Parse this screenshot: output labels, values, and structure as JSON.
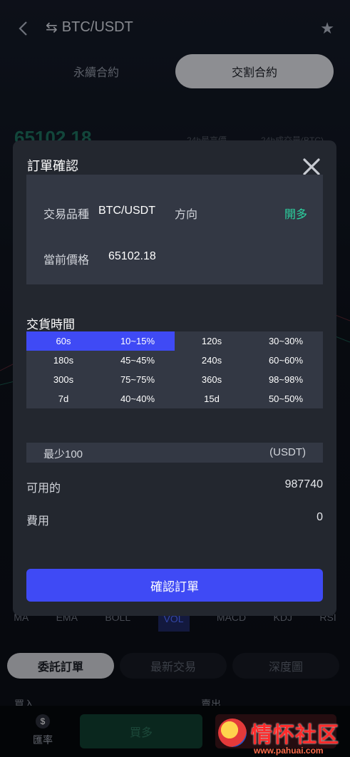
{
  "header": {
    "pair": "BTC/USDT"
  },
  "segments": [
    {
      "label": "永續合約"
    },
    {
      "label": "交割合約"
    }
  ],
  "bg_price": "65102.18",
  "bg_stats": [
    "24h最高價",
    "24h成交量(BTC)"
  ],
  "indicators": [
    "MA",
    "EMA",
    "BOLL",
    "VOL",
    "MACD",
    "KDJ",
    "RSI"
  ],
  "subtabs": [
    {
      "label": "委託訂單"
    },
    {
      "label": "最新交易"
    },
    {
      "label": "深度圖"
    }
  ],
  "buysell": {
    "buy": "買入",
    "sell": "賣出"
  },
  "bottom": {
    "rate_label": "匯率",
    "buy_label": "買多"
  },
  "watermark": {
    "text": "情怀社区",
    "url": "www.pahuai.com"
  },
  "modal": {
    "title": "訂單確認",
    "info": {
      "product_label": "交易品種",
      "product_value": "BTC/USDT",
      "direction_label": "方向",
      "direction_value": "開多",
      "price_label": "當前價格",
      "price_value": "65102.18"
    },
    "delivery_title": "交貨時間",
    "delivery_rows": [
      [
        "60s",
        "10~15%",
        "120s",
        "30~30%"
      ],
      [
        "180s",
        "45~45%",
        "240s",
        "60~60%"
      ],
      [
        "300s",
        "75~75%",
        "360s",
        "98~98%"
      ],
      [
        "7d",
        "40~40%",
        "15d",
        "50~50%"
      ]
    ],
    "amount_placeholder": "最少100",
    "amount_unit": "(USDT)",
    "available_label": "可用的",
    "available_value": "987740",
    "fee_label": "費用",
    "fee_value": "0",
    "confirm_label": "確認訂單"
  },
  "colors": {
    "accent": "#3f4af5",
    "long": "#2bd4a0",
    "modal_bg": "#23272f",
    "panel_bg": "#333844"
  }
}
